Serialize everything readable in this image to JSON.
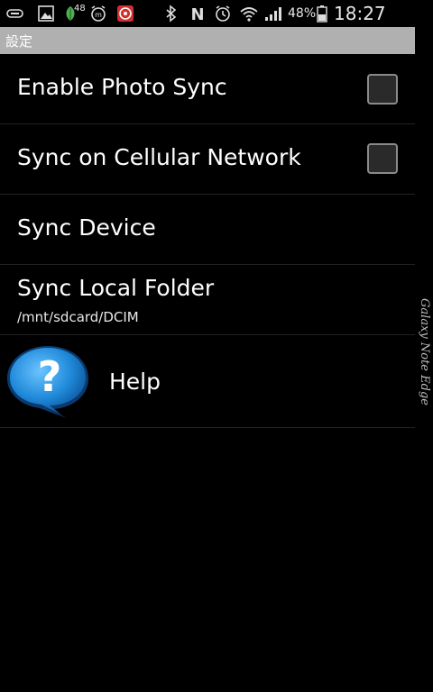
{
  "status_bar": {
    "left_icons": [
      "battery-saver-icon",
      "image-icon",
      "leaf-notification-icon",
      "alarm-clock-m-icon",
      "app-notification-icon"
    ],
    "leaf_badge": "48",
    "right_icons": [
      "bluetooth-icon",
      "nfc-icon",
      "alarm-icon",
      "wifi-icon",
      "signal-icon",
      "battery-icon"
    ],
    "battery_percent": "48%",
    "time": "18:27"
  },
  "title_bar": {
    "title": "設定"
  },
  "settings": {
    "items": [
      {
        "label": "Enable Photo Sync",
        "checked": false
      },
      {
        "label": "Sync on Cellular Network",
        "checked": false
      },
      {
        "label": "Sync Device"
      },
      {
        "label": "Sync Local Folder",
        "sublabel": "/mnt/sdcard/DCIM"
      },
      {
        "label": "Help",
        "icon": "help-bubble-icon"
      }
    ]
  },
  "edge_panel": {
    "text": "Galaxy Note Edge"
  },
  "colors": {
    "background": "#000000",
    "title_bar": "#b0b0b0",
    "help_blue": "#1e88d8",
    "notification_red": "#d32f2f",
    "leaf_green": "#4caf50"
  }
}
